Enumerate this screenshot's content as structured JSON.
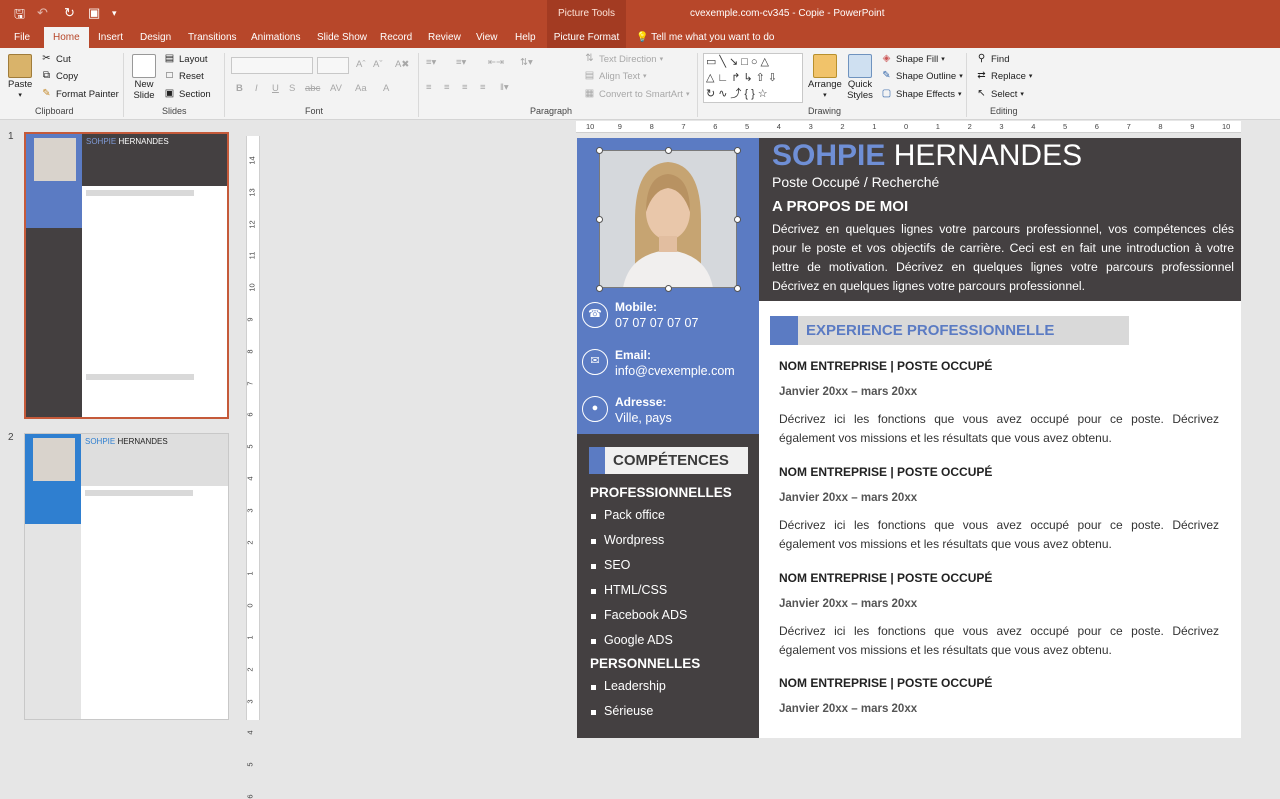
{
  "quick_access": {
    "save_icon": "save-icon",
    "undo_icon": "undo-icon",
    "repeat_icon": "repeat-icon",
    "present_icon": "start-presentation-icon",
    "customize_icon": "customize-qat-icon"
  },
  "title_bar": {
    "context_label": "Picture Tools",
    "document_title": "cvexemple.com-cv345 - Copie  -  PowerPoint"
  },
  "tabs": [
    "File",
    "Home",
    "Insert",
    "Design",
    "Transitions",
    "Animations",
    "Slide Show",
    "Record",
    "Review",
    "View",
    "Help",
    "Picture Format"
  ],
  "tell_me": "Tell me what you want to do",
  "ribbon": {
    "clipboard": {
      "paste": "Paste",
      "cut": "Cut",
      "copy": "Copy",
      "format_painter": "Format Painter",
      "label": "Clipboard"
    },
    "slides": {
      "new_slide": "New Slide",
      "layout": "Layout",
      "reset": "Reset",
      "section": "Section",
      "label": "Slides"
    },
    "font": {
      "label": "Font",
      "buttons": [
        "B",
        "I",
        "U",
        "S",
        "abc",
        "AV",
        "Aa",
        "A"
      ]
    },
    "paragraph": {
      "text_direction": "Text Direction",
      "align_text": "Align Text",
      "convert_smartart": "Convert to SmartArt",
      "label": "Paragraph"
    },
    "drawing": {
      "arrange": "Arrange",
      "quick_styles": "Quick Styles",
      "shape_fill": "Shape Fill",
      "shape_outline": "Shape Outline",
      "shape_effects": "Shape Effects",
      "label": "Drawing"
    },
    "editing": {
      "find": "Find",
      "replace": "Replace",
      "select": "Select",
      "label": "Editing"
    }
  },
  "thumbnails": [
    {
      "number": "1",
      "selected": true
    },
    {
      "number": "2",
      "selected": false
    }
  ],
  "ruler_h": [
    "10",
    "9",
    "8",
    "7",
    "6",
    "5",
    "4",
    "3",
    "2",
    "1",
    "0",
    "1",
    "2",
    "3",
    "4",
    "5",
    "6",
    "7",
    "8",
    "9",
    "10"
  ],
  "ruler_v": [
    "14",
    "13",
    "12",
    "11",
    "10",
    "9",
    "8",
    "7",
    "6",
    "5",
    "4",
    "3",
    "2",
    "1",
    "0",
    "1",
    "2",
    "3",
    "4",
    "5",
    "6"
  ],
  "slide": {
    "first_name": "SOHPIE",
    "last_name": "HERNANDES",
    "position": "Poste Occupé / Recherché",
    "about_title": "A PROPOS DE MOI",
    "about_text": "Décrivez en quelques lignes votre parcours professionnel, vos compétences clés pour le poste et vos objectifs de carrière. Ceci est en fait une introduction à votre lettre de motivation. Décrivez en quelques lignes votre parcours professionnel Décrivez en quelques lignes votre parcours professionnel.",
    "contacts": [
      {
        "label": "Mobile:",
        "value": "07 07 07 07 07",
        "icon": "phone-icon"
      },
      {
        "label": "Email:",
        "value": "info@cvexemple.com",
        "icon": "envelope-icon"
      },
      {
        "label": "Adresse:",
        "value": "Ville, pays",
        "icon": "location-pin-icon"
      }
    ],
    "competences_title": "COMPÉTENCES",
    "pro_title": "PROFESSIONNELLES",
    "pro_items": [
      "Pack office",
      "Wordpress",
      "SEO",
      "HTML/CSS",
      "Facebook ADS",
      "Google ADS"
    ],
    "perso_title": "PERSONNELLES",
    "perso_items": [
      "Leadership",
      "Sérieuse"
    ],
    "experience_title": "EXPERIENCE PROFESSIONNELLE",
    "experiences": [
      {
        "title": "NOM ENTREPRISE | POSTE OCCUPÉ",
        "dates": "Janvier 20xx – mars 20xx",
        "desc": "Décrivez ici les fonctions que vous avez occupé pour ce poste. Décrivez également vos missions et les résultats que vous avez obtenu."
      },
      {
        "title": "NOM ENTREPRISE | POSTE OCCUPÉ",
        "dates": "Janvier 20xx – mars 20xx",
        "desc": "Décrivez ici les fonctions que vous avez occupé pour ce poste. Décrivez également vos missions et les résultats que vous avez obtenu."
      },
      {
        "title": "NOM ENTREPRISE | POSTE OCCUPÉ",
        "dates": "Janvier 20xx – mars 20xx",
        "desc": "Décrivez ici les fonctions que vous avez occupé pour ce poste. Décrivez également vos missions et les résultats que vous avez obtenu."
      },
      {
        "title": "NOM ENTREPRISE | POSTE OCCUPÉ",
        "dates": "Janvier 20xx – mars 20xx",
        "desc": ""
      }
    ]
  },
  "colors": {
    "accent": "#b7472a",
    "blue": "#5b7bc3",
    "dark": "#444041",
    "slide2_blue": "#2f7fd0"
  }
}
